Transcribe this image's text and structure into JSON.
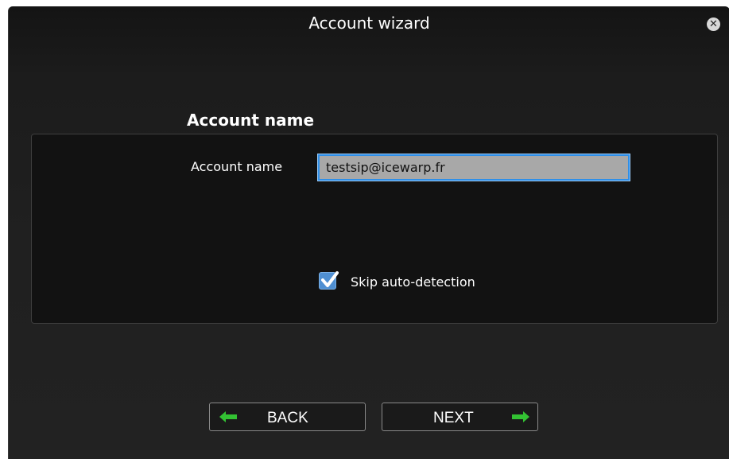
{
  "window": {
    "title": "Account wizard"
  },
  "section": {
    "title": "Account name"
  },
  "form": {
    "account_name_label": "Account name",
    "account_name_value": "testsip@icewarp.fr",
    "skip_label": "Skip auto-detection",
    "skip_checked": true
  },
  "buttons": {
    "back_label": "BACK",
    "next_label": "NEXT"
  },
  "icons": {
    "close": "close-icon",
    "back_arrow": "arrow-left-icon",
    "next_arrow": "arrow-right-icon",
    "checkmark": "checkmark-icon"
  },
  "colors": {
    "background": "#1c1c1c",
    "input_border": "#2f8fe8",
    "checkbox": "#4f8fd2",
    "arrow": "#33c233"
  }
}
